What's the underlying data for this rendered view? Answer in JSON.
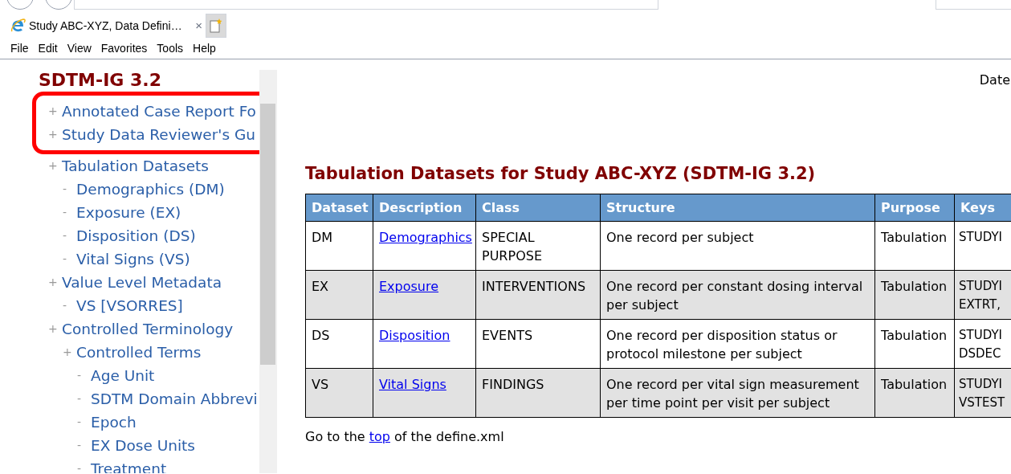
{
  "browser": {
    "tab": {
      "title": "Study ABC-XYZ, Data Defini…",
      "close": "×"
    },
    "menu": [
      "File",
      "Edit",
      "View",
      "Favorites",
      "Tools",
      "Help"
    ]
  },
  "sidebar": {
    "title": "SDTM-IG 3.2",
    "tree": [
      {
        "marker": "+",
        "label": "Annotated Case Report Fo",
        "highlighted": true
      },
      {
        "marker": "+",
        "label": "Study Data Reviewer's Gu",
        "highlighted": true
      },
      {
        "marker": "+",
        "label": "Tabulation Datasets",
        "highlighted": false,
        "children": [
          {
            "marker": "-",
            "label": "Demographics (DM)"
          },
          {
            "marker": "-",
            "label": "Exposure (EX)"
          },
          {
            "marker": "-",
            "label": "Disposition (DS)"
          },
          {
            "marker": "-",
            "label": "Vital Signs (VS)"
          }
        ]
      },
      {
        "marker": "+",
        "label": "Value Level Metadata",
        "highlighted": false,
        "children": [
          {
            "marker": "-",
            "label": "VS [VSORRES]"
          }
        ]
      },
      {
        "marker": "+",
        "label": "Controlled Terminology",
        "highlighted": false,
        "children": [
          {
            "marker": "+",
            "label": "Controlled Terms",
            "children": [
              {
                "marker": "-",
                "label": "Age Unit"
              },
              {
                "marker": "-",
                "label": "SDTM Domain Abbrevi"
              },
              {
                "marker": "-",
                "label": "Epoch"
              },
              {
                "marker": "-",
                "label": "EX Dose Units"
              },
              {
                "marker": "-",
                "label": "Treatment"
              }
            ]
          }
        ]
      }
    ]
  },
  "main": {
    "date_label": "Date",
    "heading": "Tabulation Datasets for Study ABC-XYZ (SDTM-IG 3.2)",
    "table": {
      "columns": [
        "Dataset",
        "Description",
        "Class",
        "Structure",
        "Purpose",
        "Keys"
      ],
      "rows": [
        {
          "dataset": "DM",
          "description": "Demographics",
          "class": "SPECIAL PURPOSE",
          "structure": "One record per subject",
          "purpose": "Tabulation",
          "keys": [
            "STUDYI"
          ]
        },
        {
          "dataset": "EX",
          "description": "Exposure",
          "class": "INTERVENTIONS",
          "structure": "One record per constant dosing interval per subject",
          "purpose": "Tabulation",
          "keys": [
            "STUDYI",
            "EXTRT,"
          ]
        },
        {
          "dataset": "DS",
          "description": "Disposition",
          "class": "EVENTS",
          "structure": "One record per disposition status or protocol milestone per subject",
          "purpose": "Tabulation",
          "keys": [
            "STUDYI",
            "DSDEC"
          ]
        },
        {
          "dataset": "VS",
          "description": "Vital Signs",
          "class": "FINDINGS",
          "structure": "One record per vital sign measurement per time point per visit per subject",
          "purpose": "Tabulation",
          "keys": [
            "STUDYI",
            "VSTEST"
          ]
        }
      ]
    },
    "footer": {
      "before": "Go to the",
      "link": "top",
      "after": "of the define.xml"
    }
  }
}
